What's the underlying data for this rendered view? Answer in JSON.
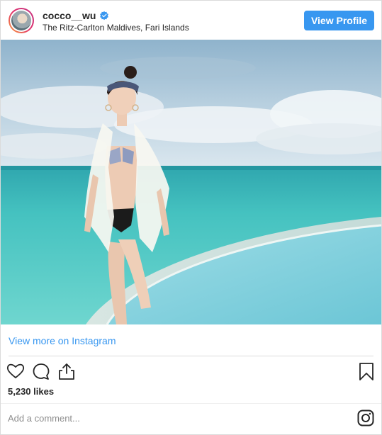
{
  "header": {
    "username": "cocco__wu",
    "location": "The Ritz-Carlton Maldives, Fari Islands",
    "view_profile_label": "View Profile",
    "verified": true
  },
  "post": {
    "image_description_icon": "photo",
    "view_more_label": "View more on Instagram",
    "likes": "5,230 likes",
    "comment_placeholder": "Add a comment..."
  },
  "icons": {
    "like": "heart-icon",
    "comment": "comment-icon",
    "share": "share-icon",
    "save": "bookmark-icon",
    "instagram": "instagram-icon"
  },
  "colors": {
    "accent": "#3897f0",
    "border": "#dbdbdb",
    "text": "#262626",
    "muted": "#8e8e8e"
  }
}
